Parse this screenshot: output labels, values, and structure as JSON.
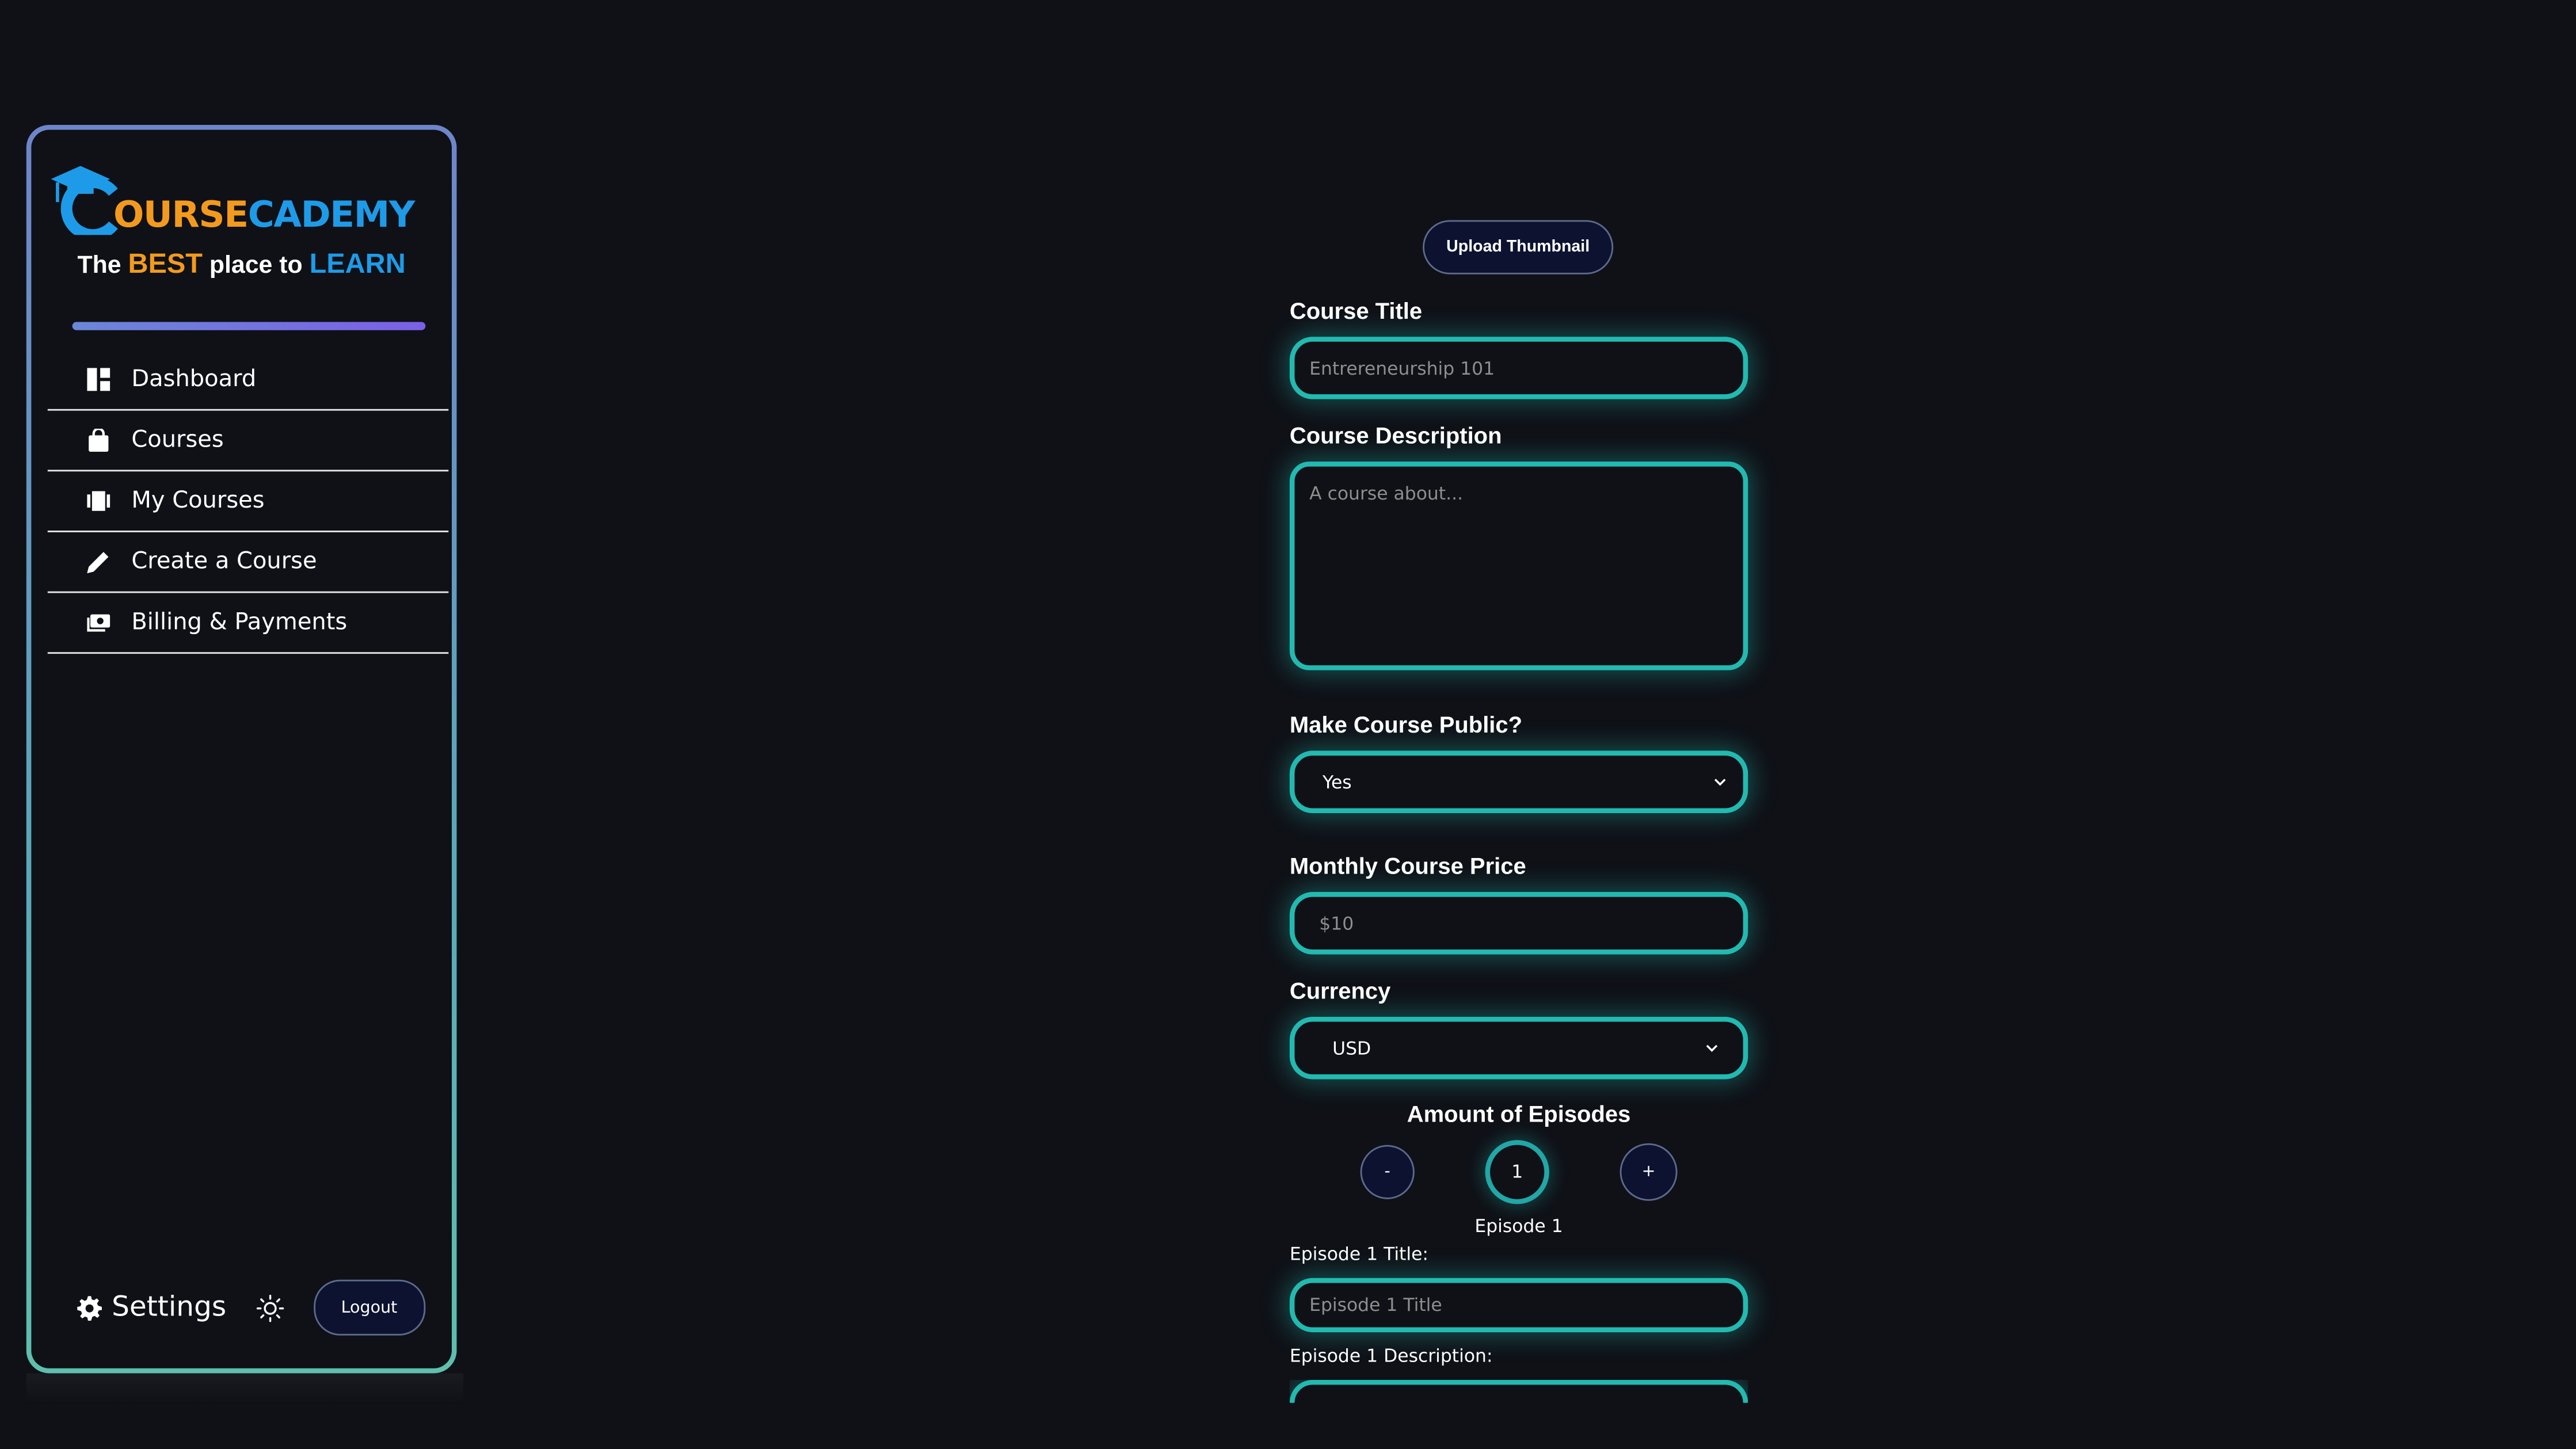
{
  "brand": {
    "logo_part1": "OURSE",
    "logo_part2": "CADEMY",
    "tagline_pre": "The ",
    "tagline_best": "BEST",
    "tagline_mid": " place to ",
    "tagline_learn": "LEARN",
    "colors": {
      "orange": "#f39a1e",
      "blue": "#1e9be8",
      "accent": "#22bab0"
    }
  },
  "sidebar": {
    "items": [
      {
        "label": "Dashboard",
        "icon": "dashboard-icon"
      },
      {
        "label": "Courses",
        "icon": "shopping-bag-icon"
      },
      {
        "label": "My Courses",
        "icon": "library-icon"
      },
      {
        "label": "Create a Course",
        "icon": "pencil-icon"
      },
      {
        "label": "Billing & Payments",
        "icon": "payments-icon"
      }
    ],
    "settings_label": "Settings",
    "logout_label": "Logout"
  },
  "form": {
    "upload_label": "Upload Thumbnail",
    "title_label": "Course Title",
    "title_placeholder": "Entrereneurship 101",
    "description_label": "Course Description",
    "description_placeholder": "A course about...",
    "public_label": "Make Course Public?",
    "public_value": "Yes",
    "price_label": "Monthly Course Price",
    "price_placeholder": "$10",
    "currency_label": "Currency",
    "currency_value": "USD",
    "episodes_label": "Amount of Episodes",
    "minus_label": "-",
    "episode_count": "1",
    "plus_label": "+",
    "episode_heading": "Episode 1",
    "episode_title_label": "Episode 1 Title:",
    "episode_title_placeholder": "Episode 1 Title",
    "episode_description_label": "Episode 1 Description:"
  }
}
